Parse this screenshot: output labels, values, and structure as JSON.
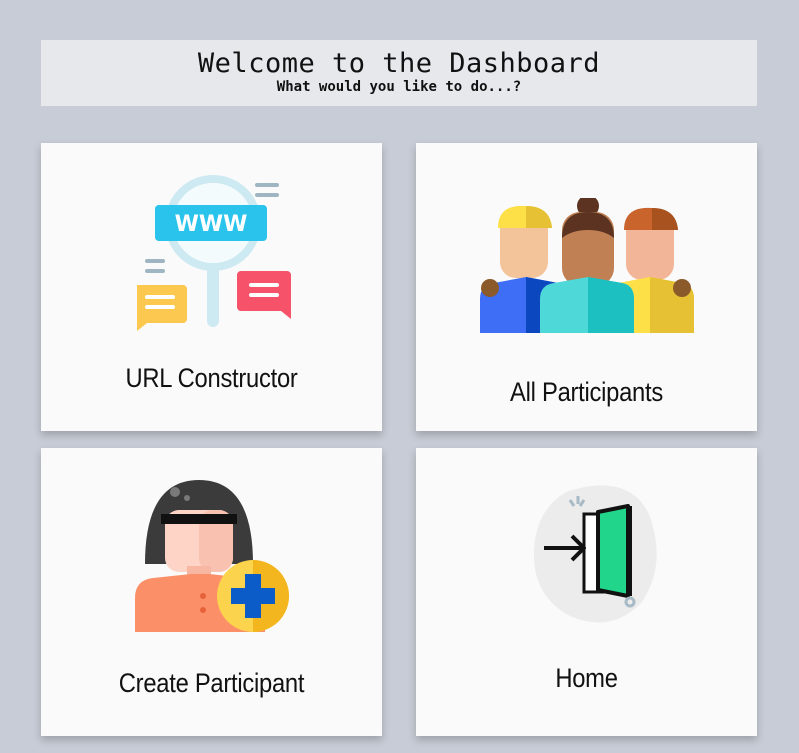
{
  "header": {
    "title": "Welcome to the Dashboard",
    "subtitle": "What would you like to do...?"
  },
  "cards": [
    {
      "label": "URL Constructor",
      "icon": "url-search-icon"
    },
    {
      "label": "All Participants",
      "icon": "participants-group-icon"
    },
    {
      "label": "Create Participant",
      "icon": "add-participant-icon"
    },
    {
      "label": "Home",
      "icon": "exit-door-icon"
    }
  ],
  "icon_text": {
    "www": "WWW"
  }
}
